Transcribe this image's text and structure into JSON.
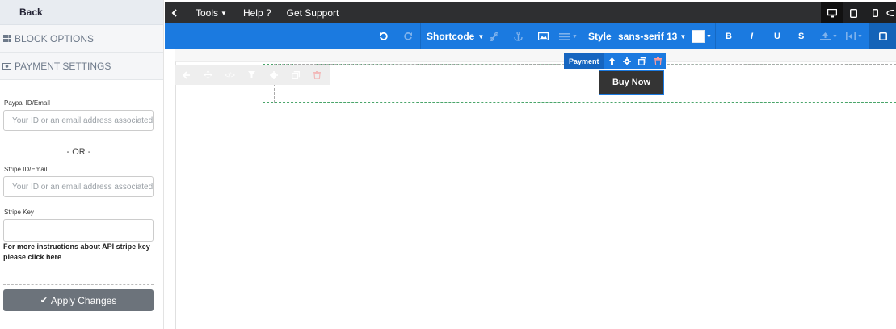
{
  "sidebar": {
    "back_label": "Back",
    "sections": [
      {
        "label": "BLOCK OPTIONS",
        "icon": "grid-icon"
      },
      {
        "label": "PAYMENT SETTINGS",
        "icon": "money-icon"
      }
    ],
    "paypal": {
      "label": "Paypal ID/Email",
      "placeholder": "Your ID or an email address associated"
    },
    "or_text": "- OR -",
    "stripe_id": {
      "label": "Stripe ID/Email",
      "placeholder": "Your ID or an email address associated"
    },
    "stripe_key": {
      "label": "Stripe Key",
      "value": ""
    },
    "api_note": "For more instructions about API stripe key please click here",
    "apply_label": "Apply Changes"
  },
  "topbar": {
    "back_icon": "chevron-left-icon",
    "menu": [
      "Tools",
      "Help ?",
      "Get Support"
    ],
    "devices": [
      "desktop-icon",
      "tablet-icon",
      "mobile-icon",
      "eye-icon"
    ]
  },
  "toolbar": {
    "shortcode_label": "Shortcode",
    "style_label": "Style",
    "font_family": "sans-serif",
    "font_size": "13",
    "bold": "B",
    "italic": "I",
    "underline": "U",
    "strike": "S"
  },
  "editor": {
    "payment_label": "Payment",
    "buy_now_label": "Buy Now"
  },
  "colors": {
    "accent": "#1b7ae0",
    "topbar": "#2e2f31",
    "button": "#6c737b"
  }
}
